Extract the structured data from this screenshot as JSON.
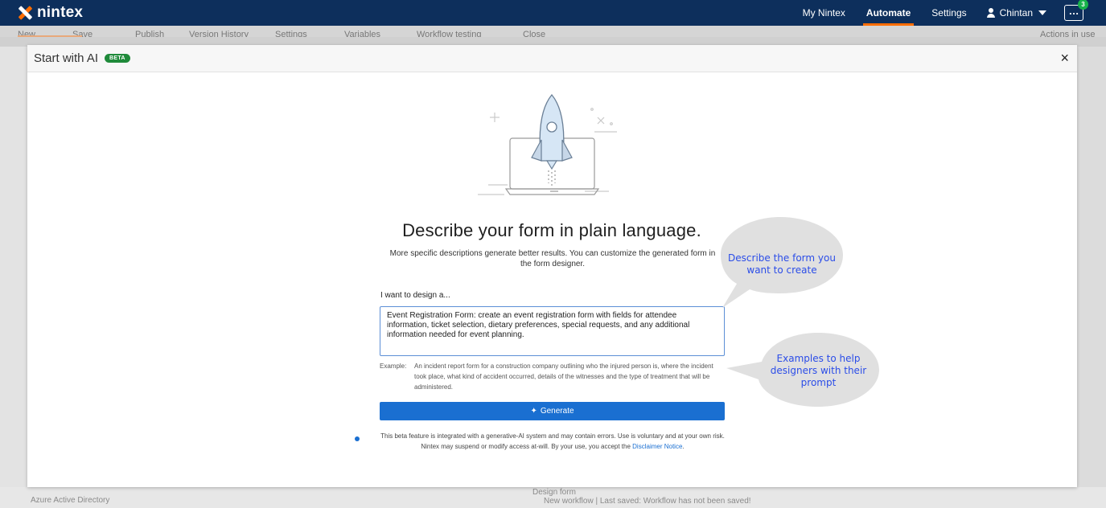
{
  "topnav": {
    "logo_text": "nintex",
    "links": [
      "My Nintex",
      "Automate",
      "Settings"
    ],
    "user_name": "Chintan",
    "more_label": "…",
    "notification_count": "3"
  },
  "toolbar": {
    "items": [
      "New",
      "Save",
      "Publish",
      "Version History",
      "Settings",
      "Variables",
      "Workflow testing",
      "Close",
      "Actions in use"
    ]
  },
  "background": {
    "bottom_left": "Azure Active Directory",
    "design_form": "Design form",
    "status": "New workflow  |  Last saved: Workflow has not been saved!"
  },
  "modal": {
    "title": "Start with AI",
    "badge": "BETA",
    "close": "×",
    "headline": "Describe your form in plain language.",
    "subtext": "More specific descriptions generate better results. You can customize the generated form in the form designer.",
    "field_label": "I want to design a...",
    "field_value": "Event Registration Form: create an event registration form with fields for attendee information, ticket selection, dietary preferences, special requests, and any additional information needed for event planning.",
    "example_label": "Example:",
    "example_text": "An incident report form for a construction company outlining who the injured person is, where the incident took place, what kind of accident occurred, details of the witnesses and the type of treatment that will be administered.",
    "generate_label": "Generate",
    "disclaimer_line1": "This beta feature is integrated with a generative-AI system and may contain errors. Use is voluntary and at your own risk.",
    "disclaimer_line2": "Nintex may suspend or modify access at-will. By your use, you accept the",
    "disclaimer_link": "Disclaimer Notice",
    "disclaimer_end": "."
  },
  "callouts": {
    "top_line1": "Describe the form you",
    "top_line2": "want to create",
    "bottom_line1": "Examples to help",
    "bottom_line2": "designers with their",
    "bottom_line3": "prompt"
  },
  "colors": {
    "nav_bg": "#0d2f5c",
    "accent_orange": "#ff6d00",
    "primary_blue": "#1a6fd1",
    "beta_green": "#1f8a3a",
    "callout_fill": "#e0e0e0",
    "callout_text": "#2b4de8"
  },
  "icons": [
    "nintex-logo-icon",
    "user-icon",
    "caret-down-icon",
    "more-icon",
    "close-icon",
    "rocket-laptop-illustration",
    "sparkle-icon",
    "info-icon"
  ]
}
